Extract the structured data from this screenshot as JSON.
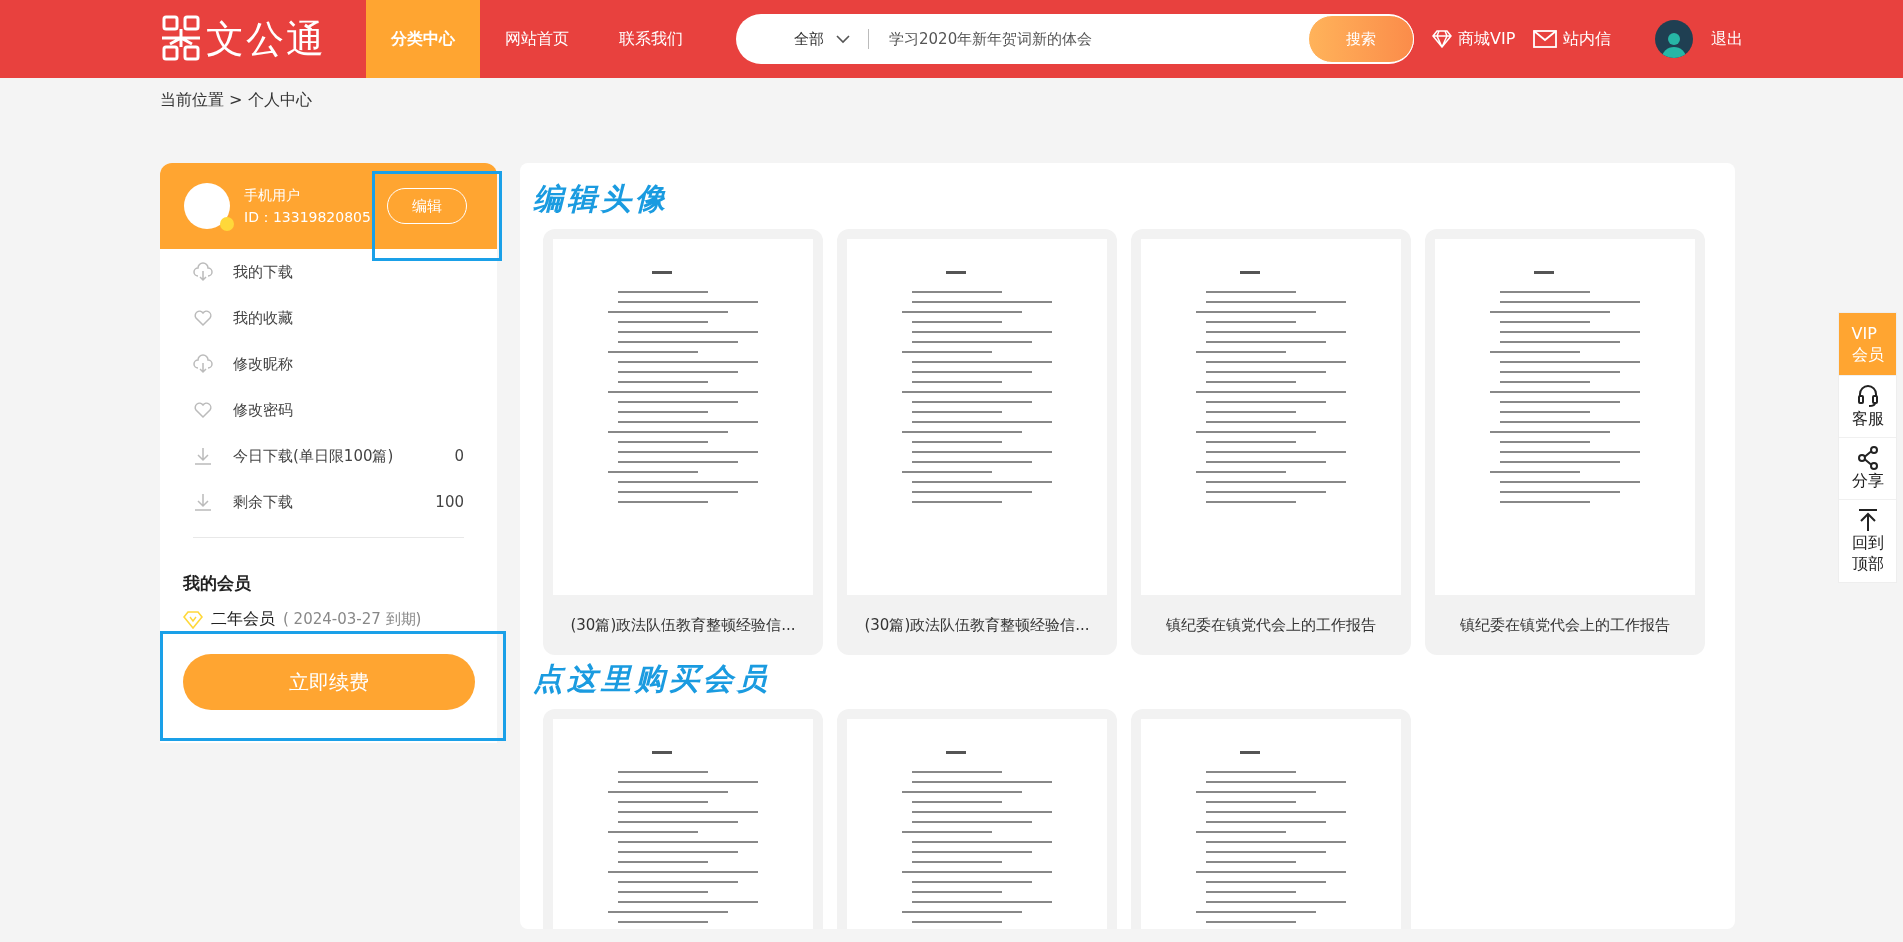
{
  "header": {
    "logo": "文公通",
    "nav": [
      {
        "label": "分类中心",
        "selected": true
      },
      {
        "label": "网站首页",
        "selected": false
      },
      {
        "label": "联系我们",
        "selected": false
      }
    ],
    "search": {
      "scope": "全部",
      "placeholder": "学习2020年新年贺词新的体会",
      "button": "搜索"
    },
    "links": [
      {
        "kind": "diamond",
        "label": "商城VIP"
      },
      {
        "kind": "mail",
        "label": "站内信"
      }
    ],
    "logout": "退出"
  },
  "breadcrumb": "当前位置 > 个人中心",
  "profile": {
    "name": "手机用户",
    "id": "ID：13319820805",
    "edit": "编辑"
  },
  "menu": [
    {
      "kind": "cloud",
      "label": "我的下载"
    },
    {
      "kind": "heart",
      "label": "我的收藏"
    },
    {
      "kind": "cloud",
      "label": "修改昵称"
    },
    {
      "kind": "heart",
      "label": "修改密码"
    },
    {
      "kind": "download",
      "label": "今日下载(单日限100篇)",
      "value": "0"
    },
    {
      "kind": "download",
      "label": "剩余下载",
      "value": "100"
    }
  ],
  "membership": {
    "title": "我的会员",
    "plan": "二年会员",
    "expiry": "( 2024-03-27 到期)",
    "button": "立即续费"
  },
  "annotations": {
    "edit_label": "编辑头像",
    "buy_label": "点这里购买会员"
  },
  "documents": [
    {
      "kind": "titled",
      "title": "(30篇)政法队伍教育整顿经验信..."
    },
    {
      "kind": "titled",
      "title": "(30篇)政法队伍教育整顿经验信..."
    },
    {
      "kind": "titled",
      "title": "镇纪委在镇党代会上的工作报告"
    },
    {
      "kind": "titled",
      "title": "镇纪委在镇党代会上的工作报告"
    },
    {
      "kind": "cut_off"
    },
    {
      "kind": "cut_off"
    },
    {
      "kind": "cut_off"
    }
  ],
  "float_bar": [
    {
      "kind": "vip",
      "lines": [
        "VIP",
        "会员"
      ]
    },
    {
      "kind": "headset",
      "lines": [
        "客服"
      ]
    },
    {
      "kind": "share",
      "lines": [
        "分享"
      ]
    },
    {
      "kind": "top",
      "lines": [
        "回到",
        "顶部"
      ]
    }
  ]
}
